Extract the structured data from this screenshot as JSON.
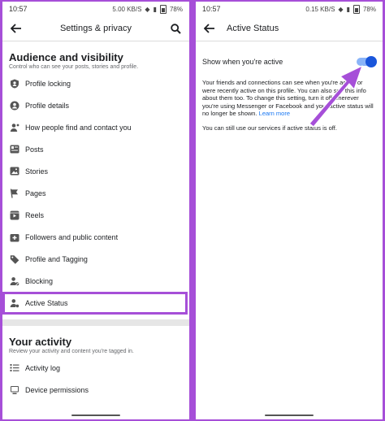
{
  "left": {
    "status": {
      "time": "10:57",
      "net": "5.00 KB/S",
      "battery": "78%"
    },
    "appbar": {
      "title": "Settings & privacy"
    },
    "audience": {
      "title": "Audience and visibility",
      "subtitle": "Control who can see your posts, stories and profile.",
      "items": [
        {
          "label": "Profile locking",
          "icon": "shield-person-icon"
        },
        {
          "label": "Profile details",
          "icon": "profile-circle-icon"
        },
        {
          "label": "How people find and contact you",
          "icon": "person-add-icon"
        },
        {
          "label": "Posts",
          "icon": "posts-icon"
        },
        {
          "label": "Stories",
          "icon": "stories-icon"
        },
        {
          "label": "Pages",
          "icon": "flag-icon"
        },
        {
          "label": "Reels",
          "icon": "reels-icon"
        },
        {
          "label": "Followers and public content",
          "icon": "followers-icon"
        },
        {
          "label": "Profile and Tagging",
          "icon": "tag-icon"
        },
        {
          "label": "Blocking",
          "icon": "block-person-icon"
        },
        {
          "label": "Active Status",
          "icon": "active-person-icon"
        }
      ]
    },
    "activity": {
      "title": "Your activity",
      "subtitle": "Review your activity and content you're tagged in.",
      "items": [
        {
          "label": "Activity log",
          "icon": "list-icon"
        },
        {
          "label": "Device permissions",
          "icon": "device-icon"
        }
      ]
    }
  },
  "right": {
    "status": {
      "time": "10:57",
      "net": "0.15 KB/S",
      "battery": "78%"
    },
    "appbar": {
      "title": "Active Status"
    },
    "toggle": {
      "label": "Show when you're active",
      "on": true
    },
    "desc_main": "Your friends and connections can see when you're active or were recently active on this profile. You can also see this info about them too. To change this setting, turn it off wherever you're using Messenger or Facebook and your active status will no longer be shown.",
    "learn_more": "Learn more",
    "desc_2": "You can still use our services if active status is off."
  },
  "colors": {
    "accent": "#a64fd8",
    "toggle_on": "#1a56db",
    "link": "#1877f2"
  }
}
